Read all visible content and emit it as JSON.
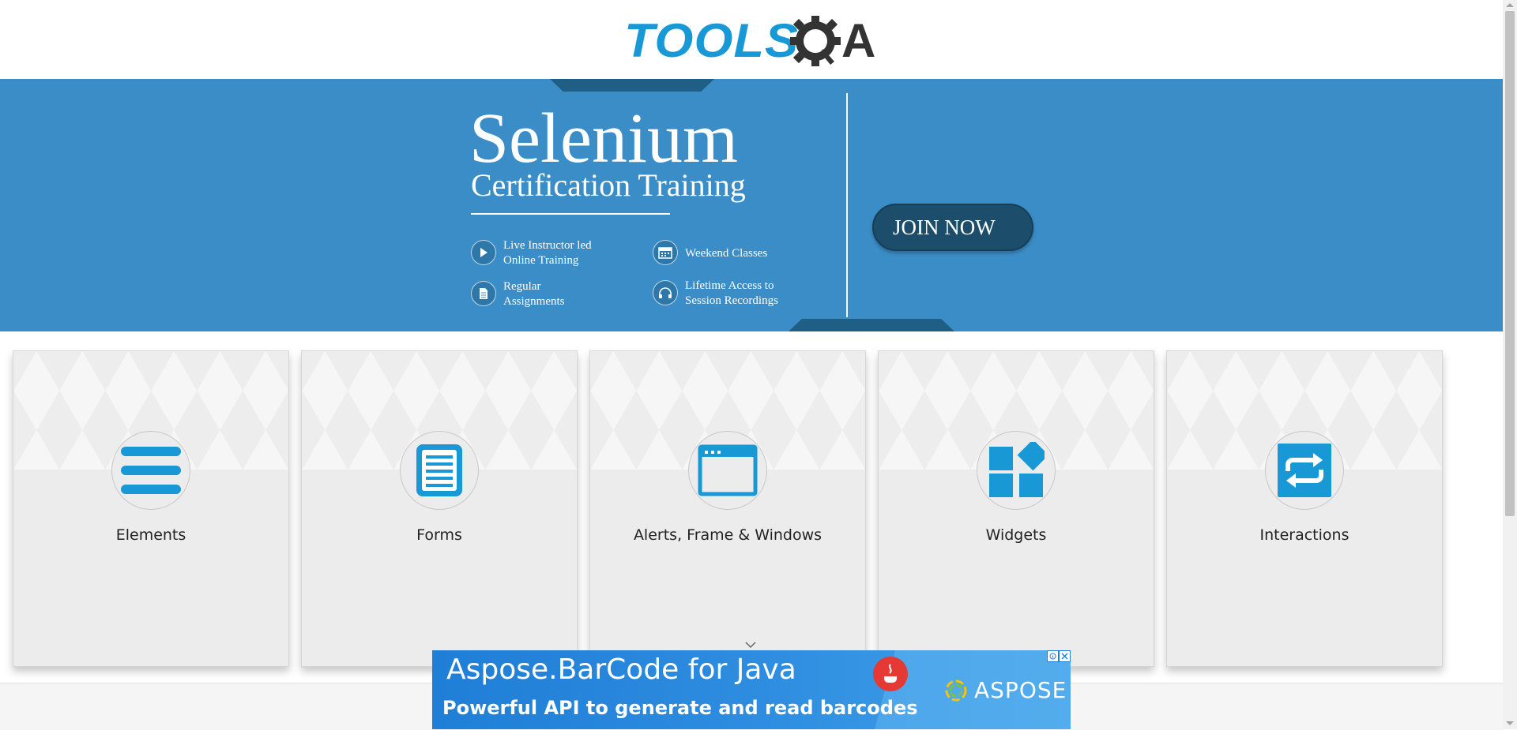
{
  "header": {
    "logo_word": "TOOLS",
    "logo_letter": "A",
    "logo_icon": "gear-magnifier-icon",
    "brand_color": "#1899d6"
  },
  "banner": {
    "title": "Selenium",
    "subtitle": "Certification Training",
    "features": [
      {
        "icon": "play-icon",
        "line1": "Live Instructor led",
        "line2": "Online Training"
      },
      {
        "icon": "calendar-icon",
        "line1": "Weekend Classes",
        "line2": ""
      },
      {
        "icon": "document-icon",
        "line1": "Regular",
        "line2": "Assignments"
      },
      {
        "icon": "headphones-icon",
        "line1": "Lifetime Access to",
        "line2": "Session Recordings"
      }
    ],
    "cta": "JOIN NOW",
    "bg_color": "#3b8dc7",
    "accent_color": "#1c4d6b"
  },
  "cards": [
    {
      "label": "Elements",
      "icon": "hamburger-menu-icon"
    },
    {
      "label": "Forms",
      "icon": "form-document-icon"
    },
    {
      "label": "Alerts, Frame & Windows",
      "icon": "browser-window-icon"
    },
    {
      "label": "Widgets",
      "icon": "widgets-grid-icon"
    },
    {
      "label": "Interactions",
      "icon": "swap-arrows-icon"
    }
  ],
  "ad": {
    "title": "Aspose.BarCode for Java",
    "subtitle": "Powerful API to generate and read barcodes",
    "brand": "ASPOSE",
    "icons": [
      "java-icon",
      "aspose-logo-icon",
      "adchoices-icon",
      "close-icon"
    ]
  },
  "colors": {
    "icon_blue": "#1899d6",
    "card_bg": "#ececec"
  }
}
